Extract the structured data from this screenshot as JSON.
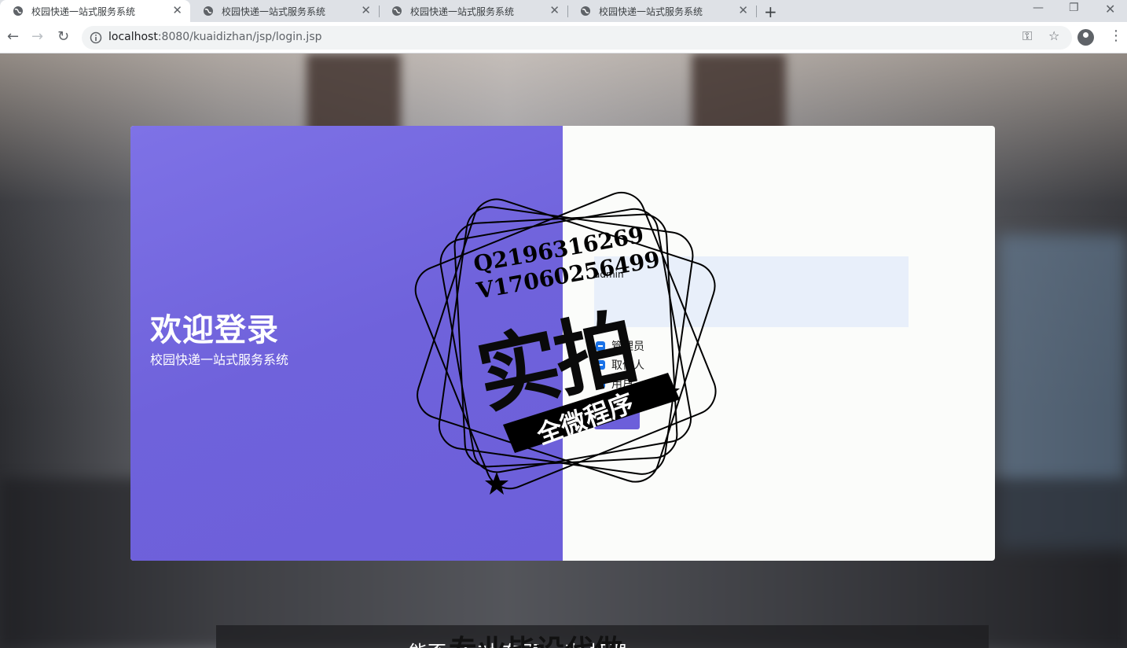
{
  "browser": {
    "tabs": [
      {
        "title": "校园快递一站式服务系统",
        "active": true
      },
      {
        "title": "校园快递一站式服务系统",
        "active": false
      },
      {
        "title": "校园快递一站式服务系统",
        "active": false
      },
      {
        "title": "校园快递一站式服务系统",
        "active": false
      }
    ],
    "new_tab": "+",
    "url_host": "localhost",
    "url_path": ":8080/kuaidizhan/jsp/login.jsp"
  },
  "login": {
    "welcome_title": "欢迎登录",
    "welcome_subtitle": "校园快递一站式服务系统",
    "username_value": "admin",
    "roles": [
      "管理员",
      "取件人",
      "用户"
    ],
    "accent_color": "#6c5fda"
  },
  "watermark": {
    "contact_q": "Q2196316269",
    "contact_v": "V17060256499",
    "big_text": "实拍",
    "banner_text": "全微程序"
  },
  "subtitle": {
    "caption": "能否 了 对 有更 一次 把课",
    "overlay": "专业毕设代做"
  }
}
